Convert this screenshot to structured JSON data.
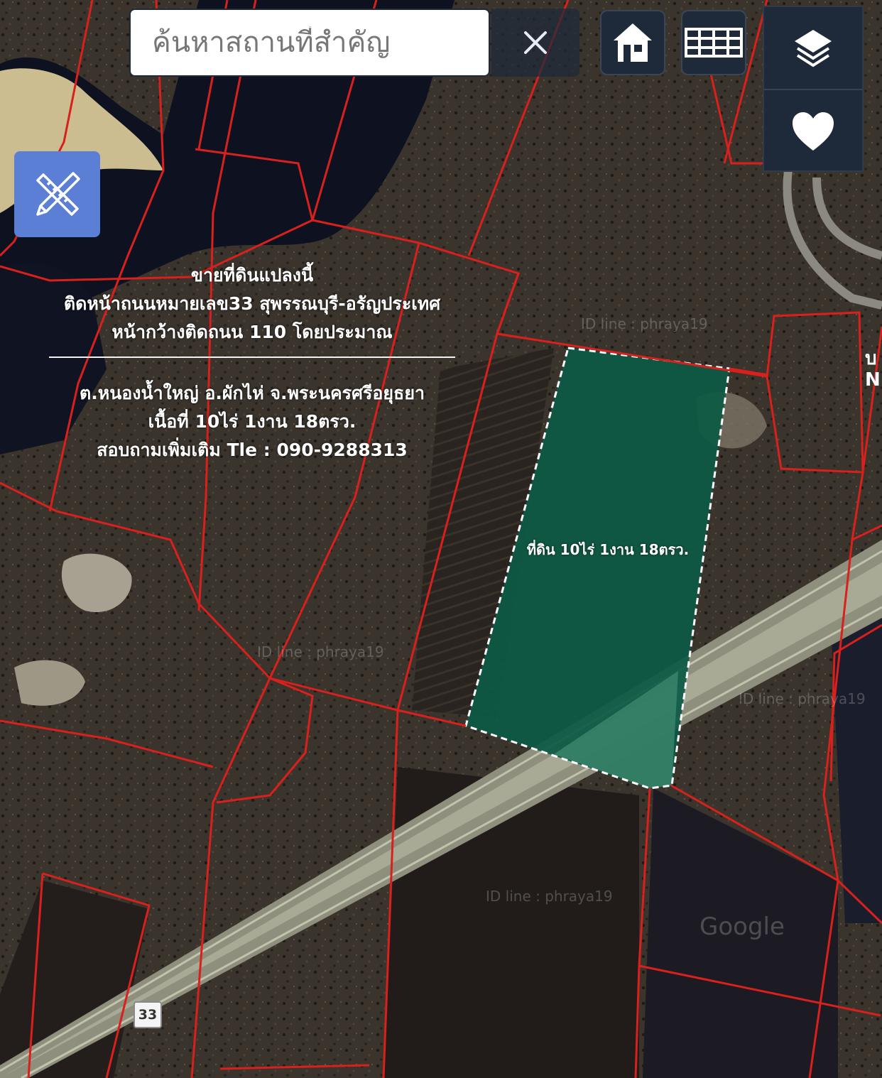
{
  "search": {
    "placeholder": "ค้นหาสถานที่สำคัญ",
    "clear_label": "×"
  },
  "controls": {
    "home_icon": "home-icon",
    "grid_icon": "grid-icon",
    "layers_icon": "layers-icon",
    "favorite_icon": "heart-icon",
    "tools_icon": "pencil-ruler-icon"
  },
  "listing": {
    "line1": "ขายที่ดินแปลงนี้",
    "line2": "ติดหน้าถนนหมายเลข33 สุพรรณบุรี-อรัญประเทศ",
    "line3": "หน้ากว้างติดถนน 110 โดยประมาณ",
    "line4": "ต.หนองน้ำใหญ่ อ.ผักไห่ จ.พระนครศรีอยุธยา",
    "line5": "เนื้อที่ 10ไร่ 1งาน 18ตรว.",
    "line6": "สอบถามเพิ่มเติม Tle : 090-9288313"
  },
  "plot": {
    "label": "ที่ดิน 10ไร่ 1งาน 18ตรว."
  },
  "road": {
    "shield": "33"
  },
  "watermarks": {
    "wm1": "ID line : phraya19",
    "wm2": "ID line : phraya19",
    "wm3": "ID line : phraya19",
    "wm4": "ID line : phraya19",
    "google": "Google"
  },
  "edge_text": "บ N",
  "colors": {
    "parcel_border": "#d8201c",
    "plot_fill": "#0d5a45",
    "control_bg": "#1e2a3a",
    "tool_btn": "#5b7fd4"
  }
}
